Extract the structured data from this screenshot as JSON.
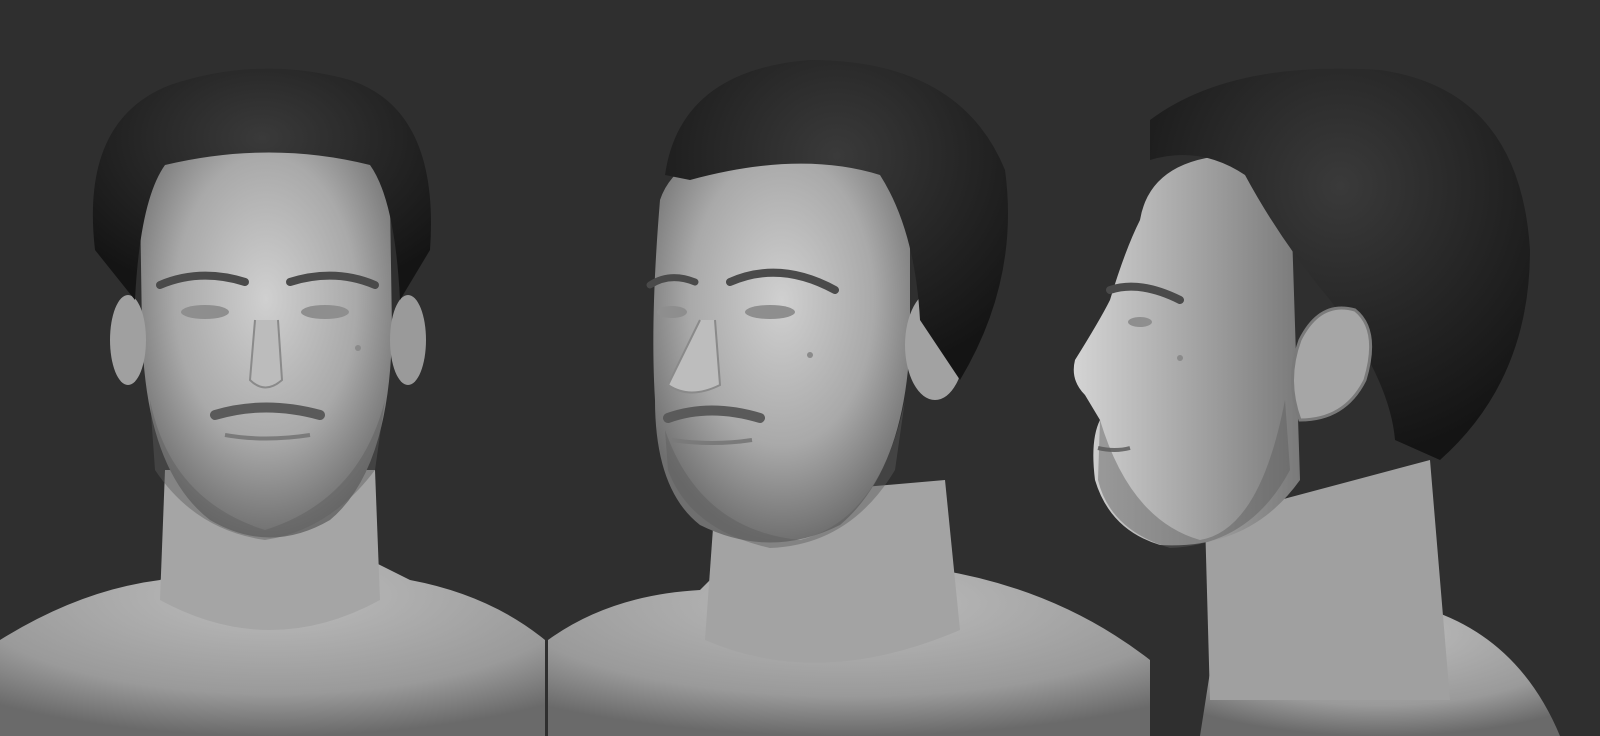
{
  "scene": {
    "background_color": "#2f2f2f",
    "skin_color": "#b8b8b8",
    "hair_color": "#1e1e1e",
    "views": [
      {
        "name": "front-view",
        "description_icon": "head-bust-front"
      },
      {
        "name": "three-quarter-view",
        "description_icon": "head-bust-three-quarter"
      },
      {
        "name": "profile-view",
        "description_icon": "head-bust-profile"
      }
    ]
  }
}
